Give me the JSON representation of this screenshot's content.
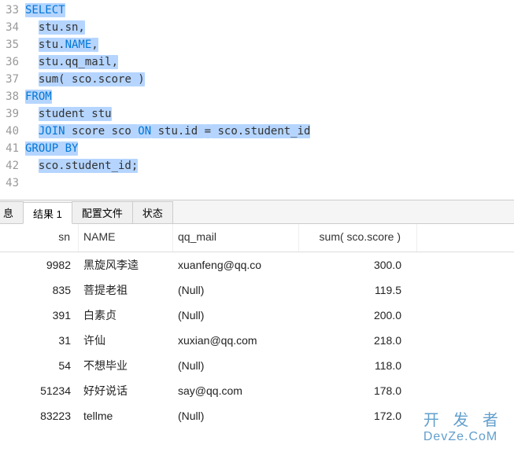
{
  "editor": {
    "lines": [
      {
        "n": "33",
        "tokens": [
          {
            "t": "SELECT",
            "c": "kw hl"
          }
        ]
      },
      {
        "n": "34",
        "tokens": [
          {
            "t": "  ",
            "c": ""
          },
          {
            "t": "stu.sn,",
            "c": "id hl"
          }
        ]
      },
      {
        "n": "35",
        "tokens": [
          {
            "t": "  ",
            "c": ""
          },
          {
            "t": "stu.",
            "c": "id hl"
          },
          {
            "t": "NAME",
            "c": "kw hl"
          },
          {
            "t": ",",
            "c": "id hl"
          }
        ]
      },
      {
        "n": "36",
        "tokens": [
          {
            "t": "  ",
            "c": ""
          },
          {
            "t": "stu.qq_mail,",
            "c": "id hl"
          }
        ]
      },
      {
        "n": "37",
        "tokens": [
          {
            "t": "  ",
            "c": ""
          },
          {
            "t": "sum",
            "c": "fn hl"
          },
          {
            "t": "( sco.score )",
            "c": "id hl"
          }
        ]
      },
      {
        "n": "38",
        "tokens": [
          {
            "t": "FROM",
            "c": "kw hl"
          }
        ]
      },
      {
        "n": "39",
        "tokens": [
          {
            "t": "  ",
            "c": ""
          },
          {
            "t": "student stu",
            "c": "id hl"
          }
        ]
      },
      {
        "n": "40",
        "tokens": [
          {
            "t": "  ",
            "c": ""
          },
          {
            "t": "JOIN",
            "c": "kw hl"
          },
          {
            "t": " score sco ",
            "c": "id hl"
          },
          {
            "t": "ON",
            "c": "kw hl"
          },
          {
            "t": " stu.id ",
            "c": "id hl"
          },
          {
            "t": "=",
            "c": "id hl"
          },
          {
            "t": " sco.student_id",
            "c": "id hl"
          }
        ]
      },
      {
        "n": "41",
        "tokens": [
          {
            "t": "GROUP BY",
            "c": "kw hl"
          }
        ]
      },
      {
        "n": "42",
        "tokens": [
          {
            "t": "  ",
            "c": ""
          },
          {
            "t": "sco.student_id;",
            "c": "id hl"
          }
        ]
      },
      {
        "n": "43",
        "tokens": [
          {
            "t": "",
            "c": ""
          }
        ]
      }
    ]
  },
  "tabs": {
    "items": [
      {
        "label": "息",
        "active": false
      },
      {
        "label": "结果 1",
        "active": true
      },
      {
        "label": "配置文件",
        "active": false
      },
      {
        "label": "状态",
        "active": false
      }
    ]
  },
  "results": {
    "columns": [
      "sn",
      "NAME",
      "qq_mail",
      "sum( sco.score )"
    ],
    "rows": [
      {
        "sn": "9982",
        "name": "黑旋风李逵",
        "mail": "xuanfeng@qq.co",
        "mail_null": false,
        "score": "300.0"
      },
      {
        "sn": "835",
        "name": "菩提老祖",
        "mail": "(Null)",
        "mail_null": true,
        "score": "119.5"
      },
      {
        "sn": "391",
        "name": "白素贞",
        "mail": "(Null)",
        "mail_null": true,
        "score": "200.0"
      },
      {
        "sn": "31",
        "name": "许仙",
        "mail": "xuxian@qq.com",
        "mail_null": false,
        "score": "218.0"
      },
      {
        "sn": "54",
        "name": "不想毕业",
        "mail": "(Null)",
        "mail_null": true,
        "score": "118.0"
      },
      {
        "sn": "51234",
        "name": "好好说话",
        "mail": "say@qq.com",
        "mail_null": false,
        "score": "178.0"
      },
      {
        "sn": "83223",
        "name": "tellme",
        "mail": "(Null)",
        "mail_null": true,
        "score": "172.0"
      }
    ]
  },
  "watermark": {
    "line1": "开 发 者",
    "line2": "DevZe.CoM"
  }
}
